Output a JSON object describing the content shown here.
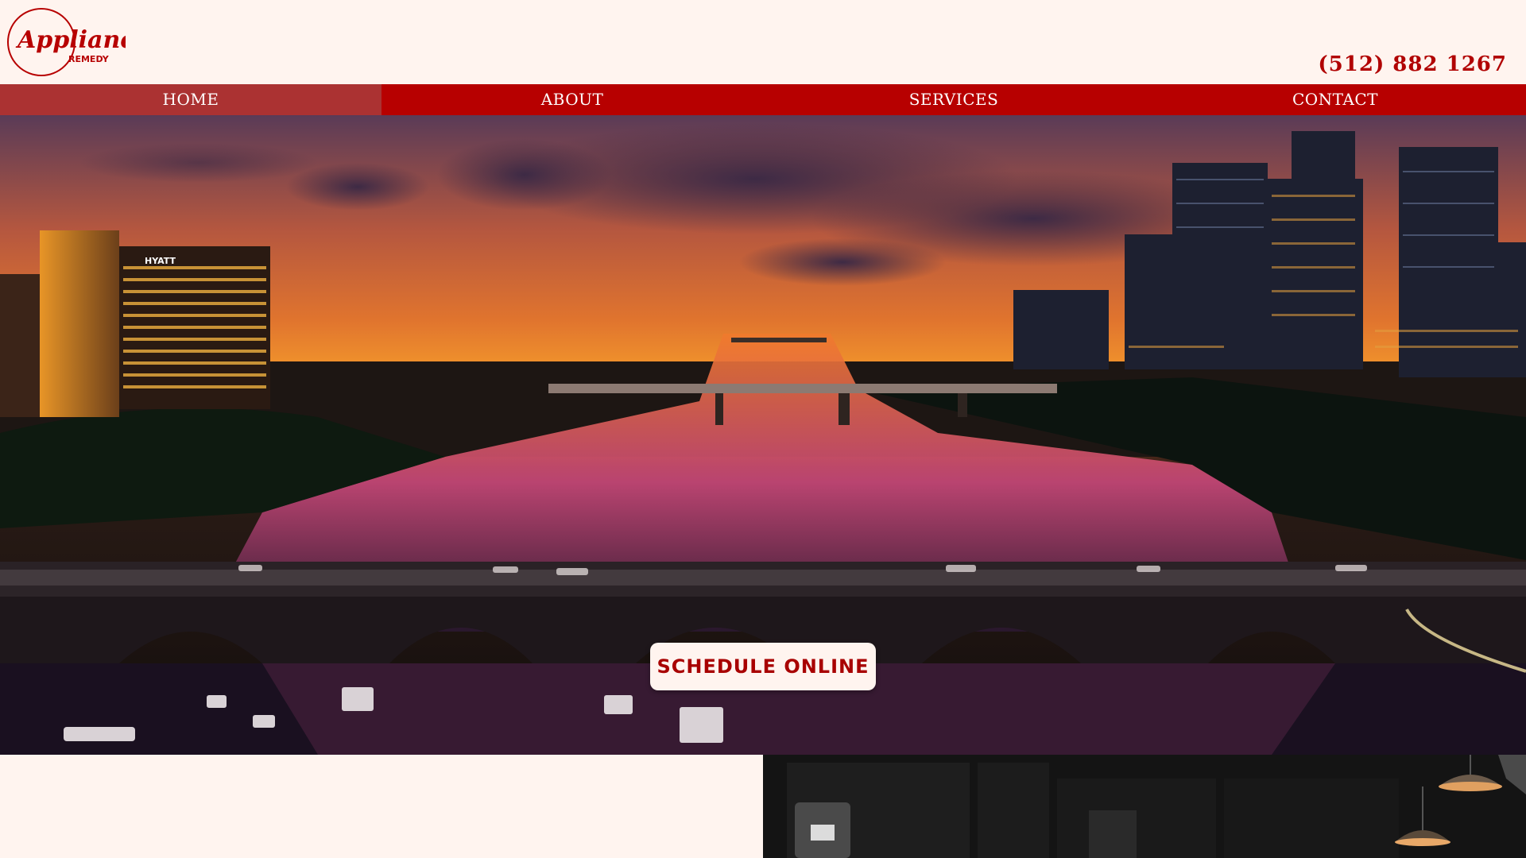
{
  "brand": {
    "logo_text_top": "Appliance",
    "logo_text_bottom": "REMEDY"
  },
  "header": {
    "phone": "(512) 882 1267"
  },
  "nav": {
    "items": [
      {
        "label": "HOME"
      },
      {
        "label": "ABOUT"
      },
      {
        "label": "SERVICES"
      },
      {
        "label": "CONTACT"
      }
    ]
  },
  "hero": {
    "cta_label": "SCHEDULE ONLINE",
    "hotel_sign": "HYATT"
  },
  "colors": {
    "brand_red": "#b70000",
    "nav_active": "#ab3232",
    "page_bg": "#fff4ef"
  }
}
